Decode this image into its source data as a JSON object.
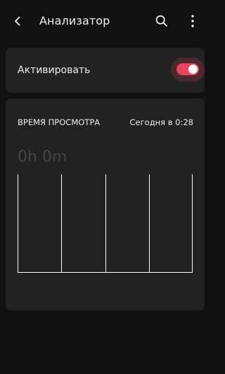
{
  "toolbar": {
    "title": "Анализатор",
    "back_icon": "back-arrow-icon",
    "search_icon": "search-icon",
    "more_icon": "more-vert-icon"
  },
  "activate": {
    "label": "Активировать",
    "enabled": true,
    "accent_color": "#e94560"
  },
  "usage": {
    "title": "ВРЕМЯ ПРОСМОТРА",
    "timestamp": "Сегодня в 0:28",
    "total": "0h 0m",
    "chart_columns": 4
  },
  "colors": {
    "background": "#111111",
    "card": "#222222",
    "accent": "#e94560",
    "muted_text": "#444444"
  }
}
